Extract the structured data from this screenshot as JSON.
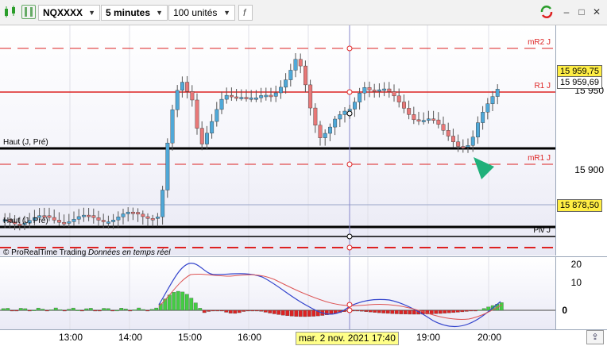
{
  "toolbar": {
    "symbol": "NQXXXX",
    "interval": "5 minutes",
    "units": "100 unités",
    "formula_button": "f"
  },
  "chart": {
    "level_labels": {
      "mr2": "mR2 J",
      "r1": "R1 J",
      "haut": "Haut (J, Pré)",
      "mr1": "mR1 J",
      "piv": "Piv J",
      "haut2": "Haut (J, Pré)"
    },
    "price_axis": {
      "tick_15950": "15 950",
      "tick_15900": "15 900",
      "current_price": "15 959,75",
      "cursor_price": "15 959,69",
      "marker_price": "15 878,50"
    },
    "copyright": "© ProRealTime Trading",
    "copyright_italic": "Données en temps réel"
  },
  "indicator": {
    "axis_labels": [
      "20",
      "10",
      "0"
    ]
  },
  "time_axis": {
    "labels": [
      "13:00",
      "14:00",
      "15:00",
      "16:00",
      "19:00",
      "20:00"
    ],
    "cursor_date": "mar. 2 nov. 2021 17:40"
  },
  "colors": {
    "up": "#4fa8d8",
    "down": "#e87878",
    "resistance": "#dd2222",
    "support": "#000000",
    "macd_up": "#44cc44",
    "macd_down": "#dd2222",
    "signal_line": "#3344cc",
    "marker": "#1fb07a"
  },
  "icons": [
    "candlestick-icon",
    "settings-icon",
    "refresh-icon",
    "minimize-icon",
    "maximize-icon",
    "close-icon",
    "scroll-icon"
  ]
}
